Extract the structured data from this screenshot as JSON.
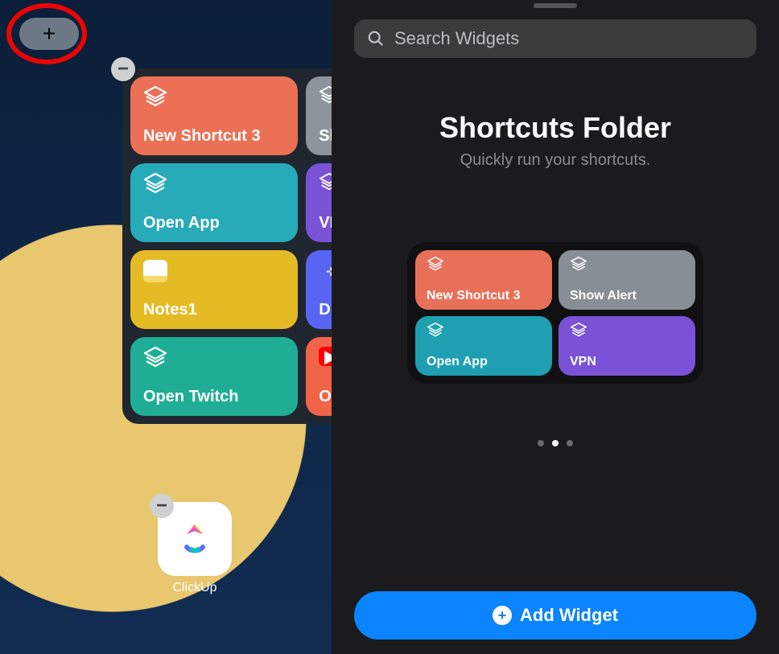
{
  "left": {
    "plus_label": "+",
    "widget": {
      "minus_label": "−",
      "tiles": [
        {
          "label": "New Shortcut 3",
          "color": "#ec7056",
          "icon": "layers"
        },
        {
          "label": "Sh",
          "color": "#8e949c",
          "icon": "layers"
        },
        {
          "label": "Open App",
          "color": "#27abbb",
          "icon": "layers"
        },
        {
          "label": "VP",
          "color": "#7b52d6",
          "icon": "layers"
        },
        {
          "label": "Notes1",
          "color": "#e4bb24",
          "icon": "notes"
        },
        {
          "label": "Di",
          "color": "#5865F2",
          "icon": "discord"
        },
        {
          "label": "Open Twitch",
          "color": "#1fae95",
          "icon": "layers"
        },
        {
          "label": "Op",
          "color": "#f26447",
          "icon": "youtube"
        }
      ]
    },
    "app": {
      "label": "ClickUp",
      "minus_label": "−"
    }
  },
  "right": {
    "search_placeholder": "Search Widgets",
    "title": "Shortcuts Folder",
    "subtitle": "Quickly run your shortcuts.",
    "preview_tiles": [
      {
        "label": "New Shortcut 3",
        "color": "#e86f58"
      },
      {
        "label": "Show Alert",
        "color": "#888e96"
      },
      {
        "label": "Open App",
        "color": "#1ea0b2"
      },
      {
        "label": "VPN",
        "color": "#7b52d6"
      }
    ],
    "page_count": 3,
    "active_page": 1,
    "add_button_label": "Add Widget"
  },
  "colors": {
    "annotation_red": "#ea0505",
    "accent_blue": "#0a84ff"
  }
}
